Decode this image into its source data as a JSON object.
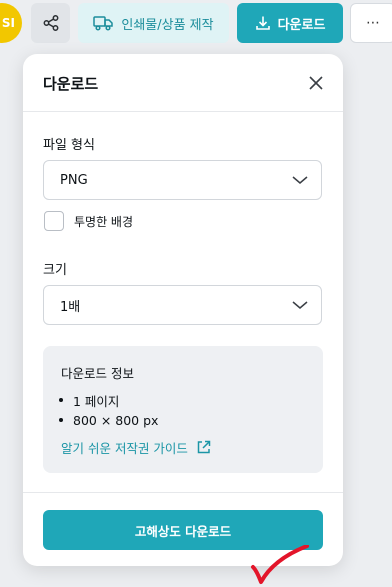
{
  "toolbar": {
    "avatar_text": "SI",
    "merch_label": "인쇄물/상품 제작",
    "download_label": "다운로드",
    "more_label": "⋯"
  },
  "panel": {
    "title": "다운로드",
    "file_format": {
      "label": "파일 형식",
      "value": "PNG"
    },
    "transparent_bg": {
      "label": "투명한 배경",
      "checked": false
    },
    "size": {
      "label": "크기",
      "value": "1배"
    },
    "info": {
      "title": "다운로드 정보",
      "items": [
        "1 페이지",
        "800 × 800 px"
      ],
      "guide_link": "알기 쉬운 저작권 가이드"
    },
    "hd_download_label": "고해상도 다운로드"
  },
  "colors": {
    "accent": "#1fa7b8",
    "accent_light": "#dff3f5",
    "annotation": "#e3152a"
  }
}
